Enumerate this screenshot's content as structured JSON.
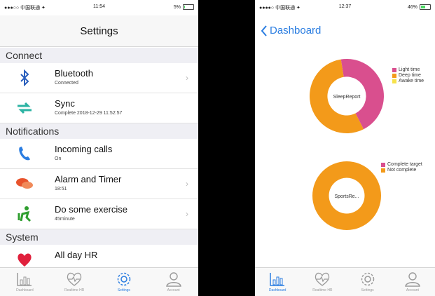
{
  "settings_screen": {
    "status": {
      "carrier": "●●●○○ 中国联通 ✦",
      "time": "11:54",
      "battery": "5%",
      "battery_level": 0.05
    },
    "title": "Settings",
    "sections": [
      {
        "header": "Connect",
        "rows": [
          {
            "icon": "bluetooth-icon",
            "title": "Bluetooth",
            "subtitle": "Connected",
            "chevron": true
          },
          {
            "icon": "sync-icon",
            "title": "Sync",
            "subtitle": "Complete  2018-12-29 11:52:57",
            "chevron": false
          }
        ]
      },
      {
        "header": "Notifications",
        "rows": [
          {
            "icon": "phone-icon",
            "title": "Incoming calls",
            "subtitle": "On",
            "chevron": false
          },
          {
            "icon": "chat-bubbles-icon",
            "title": "Alarm and Timer",
            "subtitle": "18:51",
            "chevron": true
          },
          {
            "icon": "exercise-icon",
            "title": "Do some exercise",
            "subtitle": "45minute",
            "chevron": true
          }
        ]
      },
      {
        "header": "System",
        "rows": [
          {
            "icon": "heart-icon",
            "title": "All day HR",
            "subtitle": "",
            "chevron": false
          }
        ]
      }
    ],
    "tabs": [
      {
        "icon": "bar-chart-icon",
        "label": "Dashboard",
        "active": false
      },
      {
        "icon": "heart-rate-icon",
        "label": "Realtime HR",
        "active": false
      },
      {
        "icon": "gear-icon",
        "label": "Settings",
        "active": true
      },
      {
        "icon": "person-icon",
        "label": "Account",
        "active": false
      }
    ]
  },
  "dashboard_screen": {
    "status": {
      "carrier": "●●●●○ 中国联通 ✦",
      "time": "12:37",
      "battery": "46%",
      "battery_level": 0.46
    },
    "back_label": "Dashboard",
    "tabs": [
      {
        "icon": "bar-chart-icon",
        "label": "Dashboard",
        "active": true
      },
      {
        "icon": "heart-rate-icon",
        "label": "Realtime HR",
        "active": false
      },
      {
        "icon": "gear-icon",
        "label": "Settings",
        "active": false
      },
      {
        "icon": "person-icon",
        "label": "Account",
        "active": false
      }
    ]
  },
  "colors": {
    "pink": "#d94f8e",
    "orange": "#f39a1a",
    "yellow": "#f7e24a",
    "accent": "#2a7de1"
  },
  "chart_data": [
    {
      "type": "pie",
      "variant": "donut",
      "center_label": "SleepReport",
      "categories": [
        "Light time",
        "Deep time",
        "Awake time"
      ],
      "values": [
        45,
        55,
        0
      ],
      "legend_position": "top-right"
    },
    {
      "type": "pie",
      "variant": "donut",
      "center_label": "SportsRe...",
      "categories": [
        "Complete target",
        "Not complete"
      ],
      "values": [
        0,
        100
      ],
      "legend_position": "top-right"
    }
  ]
}
